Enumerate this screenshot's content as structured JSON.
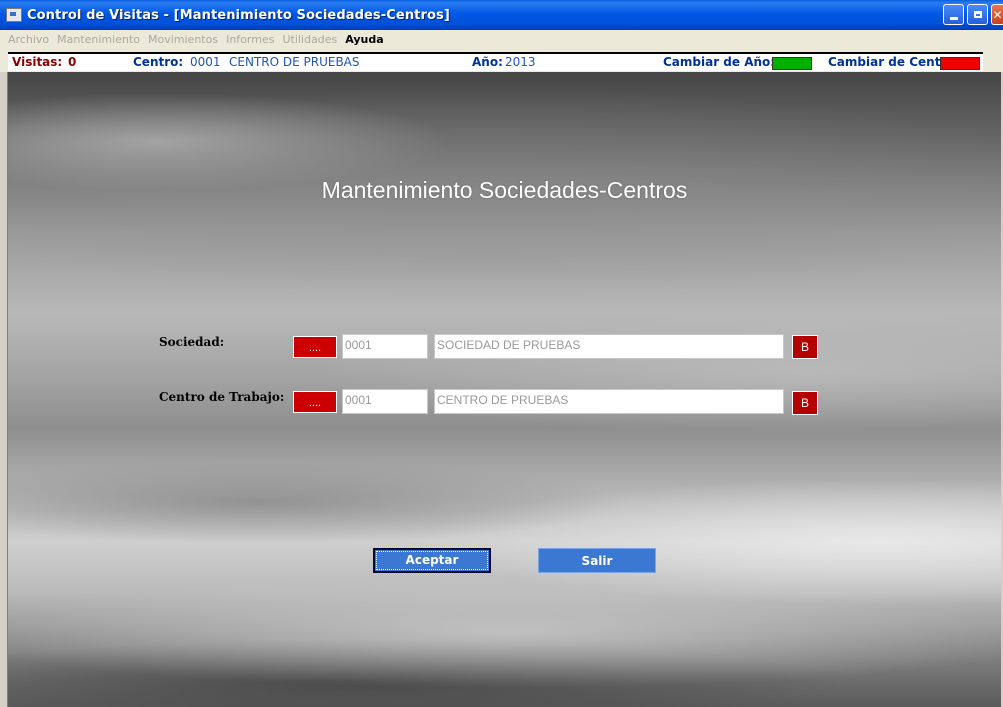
{
  "window": {
    "title": "Control de Visitas - [Mantenimiento Sociedades-Centros]"
  },
  "menu": {
    "items": [
      "Archivo",
      "Mantenimiento",
      "Movimientos",
      "Informes",
      "Utilidades",
      "Ayuda"
    ]
  },
  "status": {
    "visitas_label": "Visitas:",
    "visitas_value": "0",
    "centro_label": "Centro:",
    "centro_code": "0001",
    "centro_name": "CENTRO DE PRUEBAS",
    "anio_label": "Año:",
    "anio_value": "2013",
    "cambiar_anio_label": "Cambiar de Año:",
    "cambiar_anio_color": "#00b000",
    "cambiar_centro_label": "Cambiar de Centro:",
    "cambiar_centro_color": "#ee0000"
  },
  "form": {
    "heading": "Mantenimiento Sociedades-Centros",
    "sociedad": {
      "label": "Sociedad:",
      "lookup_label": "....",
      "code": "0001",
      "name": "SOCIEDAD DE PRUEBAS",
      "search_label": "B"
    },
    "centro": {
      "label": "Centro de Trabajo:",
      "lookup_label": "....",
      "code": "0001",
      "name": "CENTRO DE PRUEBAS",
      "search_label": "B"
    },
    "accept_label": "Aceptar",
    "exit_label": "Salir"
  },
  "icons": {
    "app": "window-app-icon",
    "minimize": "minimize-icon",
    "restore": "restore-icon",
    "close": "close-icon"
  }
}
